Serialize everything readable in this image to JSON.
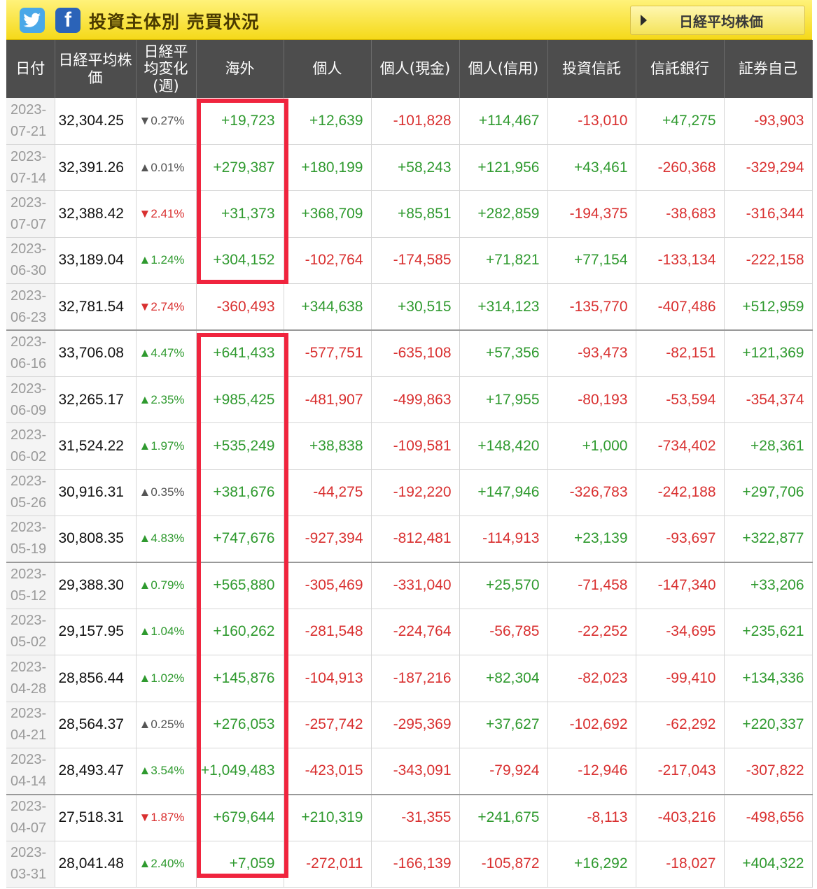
{
  "header": {
    "title": "投資主体別 売買状況",
    "nikkei_button": "日経平均株価"
  },
  "table": {
    "columns": [
      "日付",
      "日経平均株価",
      "日経平均変化(週)",
      "海外",
      "個人",
      "個人(現金)",
      "個人(信用)",
      "投資信託",
      "信託銀行",
      "証券自己"
    ],
    "rows": [
      {
        "date": "2023-07-21",
        "price": "32,304.25",
        "change": "▼0.27%",
        "dir": "down-gray",
        "vals": [
          "+19,723",
          "+12,639",
          "-101,828",
          "+114,467",
          "-13,010",
          "+47,275",
          "-93,903"
        ]
      },
      {
        "date": "2023-07-14",
        "price": "32,391.26",
        "change": "▲0.01%",
        "dir": "up-gray",
        "vals": [
          "+279,387",
          "+180,199",
          "+58,243",
          "+121,956",
          "+43,461",
          "-260,368",
          "-329,294"
        ]
      },
      {
        "date": "2023-07-07",
        "price": "32,388.42",
        "change": "▼2.41%",
        "dir": "down",
        "vals": [
          "+31,373",
          "+368,709",
          "+85,851",
          "+282,859",
          "-194,375",
          "-38,683",
          "-316,344"
        ]
      },
      {
        "date": "2023-06-30",
        "price": "33,189.04",
        "change": "▲1.24%",
        "dir": "up",
        "vals": [
          "+304,152",
          "-102,764",
          "-174,585",
          "+71,821",
          "+77,154",
          "-133,134",
          "-222,158"
        ]
      },
      {
        "date": "2023-06-23",
        "price": "32,781.54",
        "change": "▼2.74%",
        "dir": "down",
        "vals": [
          "-360,493",
          "+344,638",
          "+30,515",
          "+314,123",
          "-135,770",
          "-407,486",
          "+512,959"
        ]
      },
      {
        "date": "2023-06-16",
        "price": "33,706.08",
        "change": "▲4.47%",
        "dir": "up",
        "vals": [
          "+641,433",
          "-577,751",
          "-635,108",
          "+57,356",
          "-93,473",
          "-82,151",
          "+121,369"
        ]
      },
      {
        "date": "2023-06-09",
        "price": "32,265.17",
        "change": "▲2.35%",
        "dir": "up",
        "vals": [
          "+985,425",
          "-481,907",
          "-499,863",
          "+17,955",
          "-80,193",
          "-53,594",
          "-354,374"
        ]
      },
      {
        "date": "2023-06-02",
        "price": "31,524.22",
        "change": "▲1.97%",
        "dir": "up",
        "vals": [
          "+535,249",
          "+38,838",
          "-109,581",
          "+148,420",
          "+1,000",
          "-734,402",
          "+28,361"
        ]
      },
      {
        "date": "2023-05-26",
        "price": "30,916.31",
        "change": "▲0.35%",
        "dir": "up-gray",
        "vals": [
          "+381,676",
          "-44,275",
          "-192,220",
          "+147,946",
          "-326,783",
          "-242,188",
          "+297,706"
        ]
      },
      {
        "date": "2023-05-19",
        "price": "30,808.35",
        "change": "▲4.83%",
        "dir": "up",
        "vals": [
          "+747,676",
          "-927,394",
          "-812,481",
          "-114,913",
          "+23,139",
          "-93,697",
          "+322,877"
        ]
      },
      {
        "date": "2023-05-12",
        "price": "29,388.30",
        "change": "▲0.79%",
        "dir": "up",
        "vals": [
          "+565,880",
          "-305,469",
          "-331,040",
          "+25,570",
          "-71,458",
          "-147,340",
          "+33,206"
        ]
      },
      {
        "date": "2023-05-02",
        "price": "29,157.95",
        "change": "▲1.04%",
        "dir": "up",
        "vals": [
          "+160,262",
          "-281,548",
          "-224,764",
          "-56,785",
          "-22,252",
          "-34,695",
          "+235,621"
        ]
      },
      {
        "date": "2023-04-28",
        "price": "28,856.44",
        "change": "▲1.02%",
        "dir": "up",
        "vals": [
          "+145,876",
          "-104,913",
          "-187,216",
          "+82,304",
          "-82,023",
          "-99,410",
          "+134,336"
        ]
      },
      {
        "date": "2023-04-21",
        "price": "28,564.37",
        "change": "▲0.25%",
        "dir": "up-gray",
        "vals": [
          "+276,053",
          "-257,742",
          "-295,369",
          "+37,627",
          "-102,692",
          "-62,292",
          "+220,337"
        ]
      },
      {
        "date": "2023-04-14",
        "price": "28,493.47",
        "change": "▲3.54%",
        "dir": "up",
        "vals": [
          "+1,049,483",
          "-423,015",
          "-343,091",
          "-79,924",
          "-12,946",
          "-217,043",
          "-307,822"
        ]
      },
      {
        "date": "2023-04-07",
        "price": "27,518.31",
        "change": "▼1.87%",
        "dir": "down",
        "vals": [
          "+679,644",
          "+210,319",
          "-31,355",
          "+241,675",
          "-8,113",
          "-403,216",
          "-498,656"
        ]
      },
      {
        "date": "2023-03-31",
        "price": "28,041.48",
        "change": "▲2.40%",
        "dir": "up",
        "vals": [
          "+7,059",
          "-272,011",
          "-166,139",
          "-105,872",
          "+16,292",
          "-18,027",
          "+404,322"
        ]
      }
    ]
  },
  "colors": {
    "header_bar": "#f5d91a",
    "table_header": "#4d4d4d",
    "positive": "#2f9a2f",
    "negative": "#d93030",
    "highlight": "#f0243e"
  }
}
